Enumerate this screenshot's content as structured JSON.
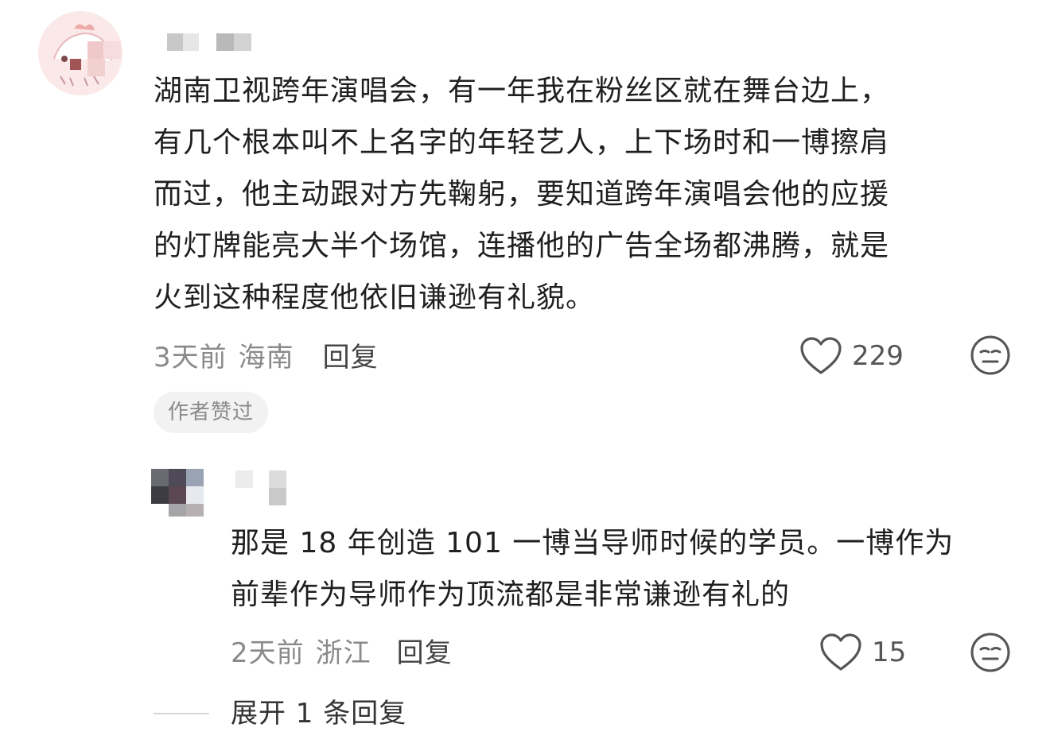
{
  "comment": {
    "text": "湖南卫视跨年演唱会，有一年我在粉丝区就在舞台边上，\n有几个根本叫不上名字的年轻艺人，上下场时和一博擦肩\n而过，他主动跟对方先鞠躬，要知道跨年演唱会他的应援\n的灯牌能亮大半个场馆，连播他的广告全场都沸腾，就是\n火到这种程度他依旧谦逊有礼貌。",
    "time": "3天前",
    "location": "海南",
    "reply_label": "回复",
    "likes": "229",
    "author_liked_badge": "作者赞过"
  },
  "reply": {
    "text": "那是 18 年创造 101 一博当导师时候的学员。一博作为\n前辈作为导师作为顶流都是非常谦逊有礼的",
    "time": "2天前",
    "location": "浙江",
    "reply_label": "回复",
    "likes": "15"
  },
  "expand_label": "展开 1 条回复",
  "icons": {
    "like": "heart-outline-icon",
    "dislike": "unamused-face-icon"
  },
  "colors": {
    "text": "#1f1f1f",
    "meta": "#8a8a8a",
    "badge_bg": "#f2f2f2",
    "avatar_bg": "#fbeaea"
  }
}
